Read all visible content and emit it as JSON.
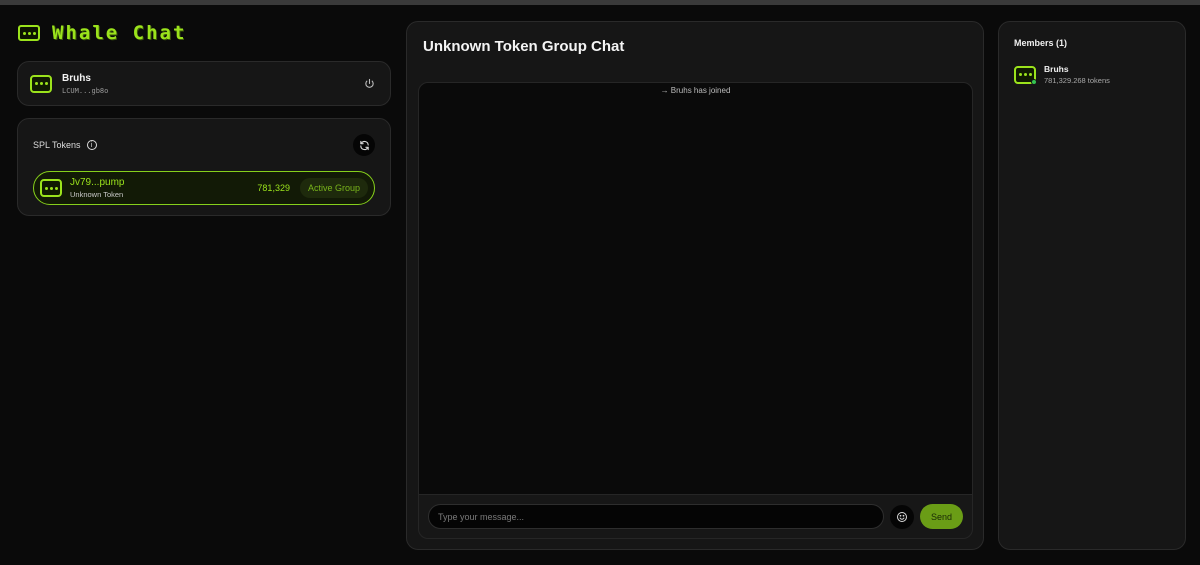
{
  "app": {
    "title": "Whale Chat",
    "accent_color": "#9be31c"
  },
  "user": {
    "name": "Bruhs",
    "address": "LCUM...gb8o",
    "logout_icon": "power-icon"
  },
  "tokens_panel": {
    "title": "SPL Tokens",
    "info_icon": "info-icon",
    "refresh_icon": "refresh-icon",
    "tokens": [
      {
        "symbol": "Jv79...pump",
        "name": "Unknown Token",
        "amount": "781,329",
        "status": "Active Group"
      }
    ]
  },
  "chat": {
    "title": "Unknown Token Group Chat",
    "messages": [
      {
        "type": "system",
        "text": "→ Bruhs has joined"
      }
    ],
    "input_placeholder": "Type your message...",
    "emoji_icon": "smiley-icon",
    "send_label": "Send"
  },
  "members": {
    "title": "Members (1)",
    "list": [
      {
        "name": "Bruhs",
        "tokens": "781,329.268 tokens",
        "online": true
      }
    ]
  }
}
